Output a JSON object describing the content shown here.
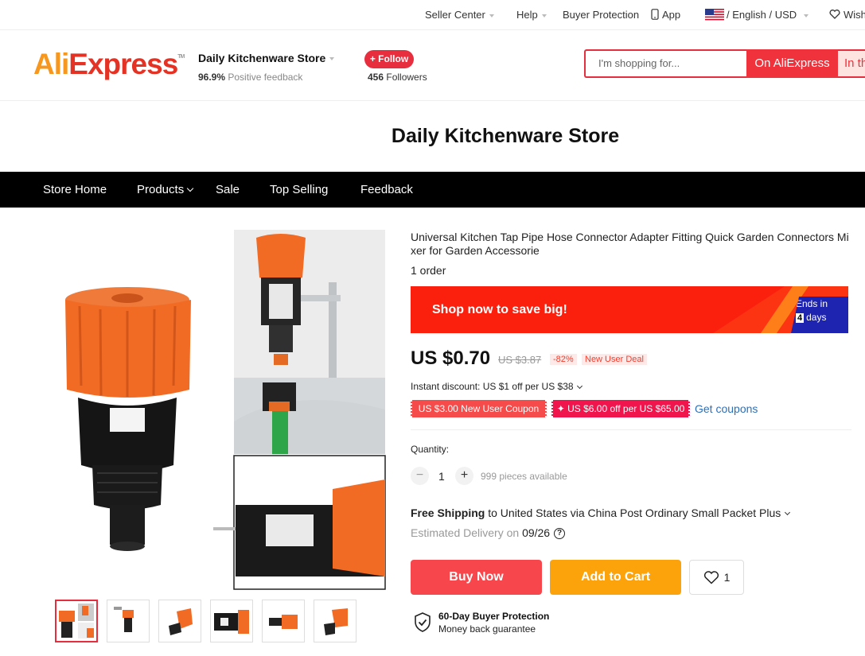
{
  "topbar": {
    "seller_center": "Seller Center",
    "help": "Help",
    "buyer_protection": "Buyer Protection",
    "app": "App",
    "language": "/ English / USD",
    "wishlist": "Wish"
  },
  "header": {
    "logo": {
      "part1": "Ali",
      "part2": "Express",
      "tm": "TM"
    },
    "store_name": "Daily Kitchenware Store",
    "feedback_pct": "96.9%",
    "feedback_label": "Positive feedback",
    "follow_label": "+ Follow",
    "followers_count": "456",
    "followers_label": "Followers",
    "search_placeholder": "I'm shopping for...",
    "search_btn": "On AliExpress",
    "search_btn2": "In this store"
  },
  "banner": {
    "title": "Daily Kitchenware Store"
  },
  "nav": {
    "items": [
      "Store Home",
      "Products",
      "Sale",
      "Top Selling",
      "Feedback"
    ]
  },
  "product": {
    "title": "Universal Kitchen Tap Pipe Hose Connector Adapter Fitting Quick Garden Connectors Mixer for Garden Accessorie",
    "orders": "1 order",
    "promo": {
      "text": "Shop now to save big!",
      "ends_label": "Ends in",
      "ends_days": "4",
      "ends_unit": "days"
    },
    "price": "US $0.70",
    "old_price": "US $3.87",
    "discount": "-82%",
    "new_user_deal": "New User Deal",
    "instant_discount": "Instant discount: US $1 off per US $38",
    "coupon1": "US $3.00 New User Coupon",
    "coupon2": "US $6.00 off per US $65.00",
    "get_coupons": "Get coupons",
    "quantity_label": "Quantity:",
    "quantity_value": "1",
    "available": "999 pieces available",
    "shipping_bold": "Free Shipping",
    "shipping_rest": "to United States via China Post Ordinary Small Packet Plus",
    "estimated_label": "Estimated Delivery on",
    "estimated_date": "09/26",
    "buy_now": "Buy Now",
    "add_to_cart": "Add to Cart",
    "wish_count": "1",
    "protection_title": "60-Day Buyer Protection",
    "protection_sub": "Money back guarantee"
  },
  "colors": {
    "brand_red": "#e62e3e",
    "orange": "#f7971d",
    "cart": "#fca30c",
    "buy": "#f7464c"
  }
}
